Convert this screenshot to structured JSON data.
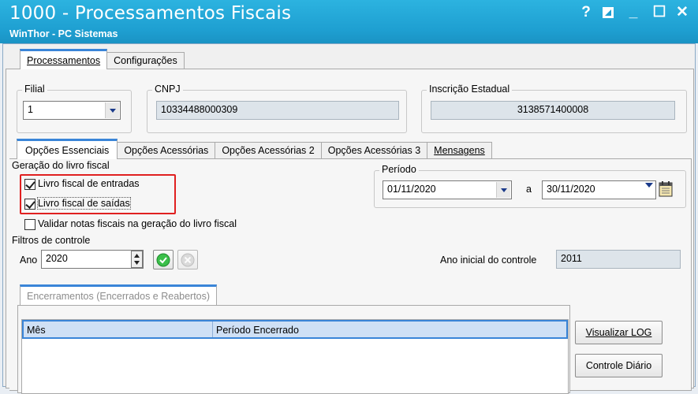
{
  "window": {
    "title": "1000 - Processamentos Fiscais",
    "subtitle": "WinThor - PC Sistemas",
    "controls": {
      "help": "?",
      "restore_icon": "restore-icon",
      "minimize": "_",
      "maximize": "☐",
      "close": "✕"
    }
  },
  "top_tabs": [
    "Processamentos",
    "Configurações"
  ],
  "filial": {
    "label": "Filial",
    "value": "1"
  },
  "cnpj": {
    "label": "CNPJ",
    "value": "10334488000309"
  },
  "ie": {
    "label": "Inscrição Estadual",
    "value": "3138571400008"
  },
  "sub_tabs": [
    "Opções Essenciais",
    "Opções Acessórias",
    "Opções Acessórias 2",
    "Opções Acessórias 3",
    "Mensagens"
  ],
  "geracao": {
    "label": "Geração do livro fiscal",
    "entradas": {
      "label": "Livro fiscal de entradas",
      "checked": true
    },
    "saidas": {
      "label": "Livro fiscal de saídas",
      "checked": true
    },
    "validar": {
      "label": "Validar notas fiscais na geração do livro fiscal",
      "checked": false
    }
  },
  "periodo": {
    "label": "Período",
    "from": "01/11/2020",
    "sep": "a",
    "to": "30/11/2020"
  },
  "filtros": {
    "label": "Filtros de controle",
    "ano_label": "Ano",
    "ano_value": "2020",
    "ano_inicial_label": "Ano inicial do controle",
    "ano_inicial_value": "2011"
  },
  "enc_tab": "Encerramentos (Encerrados e Reabertos)",
  "table": {
    "columns": [
      "Mês",
      "Período Encerrado"
    ],
    "rows": []
  },
  "buttons": {
    "log": "Visualizar LOG",
    "diario": "Controle Diário"
  },
  "colors": {
    "titlebar": "#1e9fd1",
    "highlight": "#e02020",
    "tab_accent": "#3a85d8",
    "grid_header": "#cfe0f5"
  }
}
